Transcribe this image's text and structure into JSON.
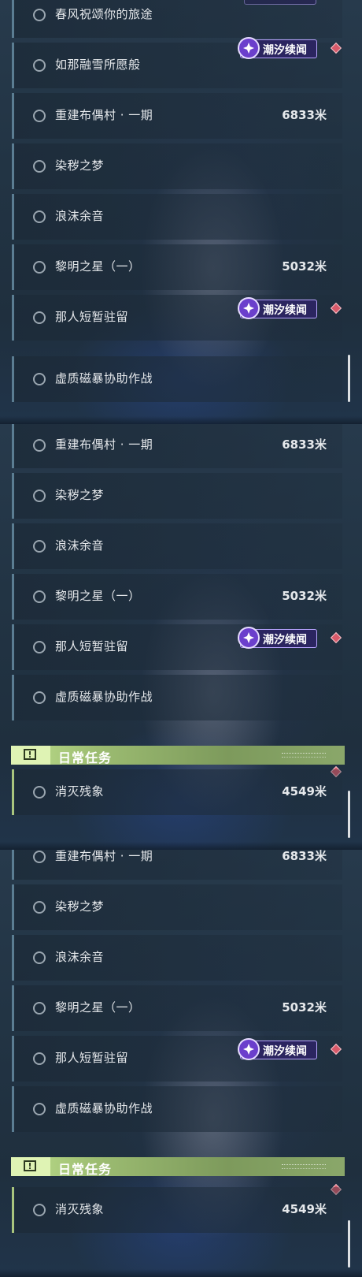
{
  "tag_label": "潮汐续闻",
  "panel_1": {
    "quests": [
      {
        "name": "春风祝颂你的旅途",
        "distance": ""
      },
      {
        "name": "如那融雪所愿般",
        "distance": ""
      },
      {
        "name": "重建布偶村 · 一期",
        "distance": "6833米"
      },
      {
        "name": "染秽之梦",
        "distance": ""
      },
      {
        "name": "浪沫余音",
        "distance": ""
      },
      {
        "name": "黎明之星（一）",
        "distance": "5032米"
      },
      {
        "name": "那人短暂驻留",
        "distance": ""
      },
      {
        "name": "虚质磁暴协助作战",
        "distance": ""
      }
    ]
  },
  "panel_2": {
    "quests": [
      {
        "name": "重建布偶村 · 一期",
        "distance": "6833米"
      },
      {
        "name": "染秽之梦",
        "distance": ""
      },
      {
        "name": "浪沫余音",
        "distance": ""
      },
      {
        "name": "黎明之星（一）",
        "distance": "5032米"
      },
      {
        "name": "那人短暂驻留",
        "distance": ""
      },
      {
        "name": "虚质磁暴协助作战",
        "distance": ""
      }
    ],
    "section_title": "日常任务",
    "daily_quests": [
      {
        "name": "消灭残象",
        "distance": "4549米"
      }
    ]
  },
  "panel_3": {
    "quests": [
      {
        "name": "重建布偶村 · 一期",
        "distance": "6833米"
      },
      {
        "name": "染秽之梦",
        "distance": ""
      },
      {
        "name": "浪沫余音",
        "distance": ""
      },
      {
        "name": "黎明之星（一）",
        "distance": "5032米"
      },
      {
        "name": "那人短暂驻留",
        "distance": ""
      },
      {
        "name": "虚质磁暴协助作战",
        "distance": ""
      }
    ],
    "section_title": "日常任务",
    "daily_quests": [
      {
        "name": "消灭残象",
        "distance": "4549米"
      }
    ]
  },
  "section_badge_glyph": "!",
  "colors": {
    "tag_purple": "#6b3fcc",
    "tracker_red": "#d85a6a",
    "daily_green": "#a9c57e"
  }
}
